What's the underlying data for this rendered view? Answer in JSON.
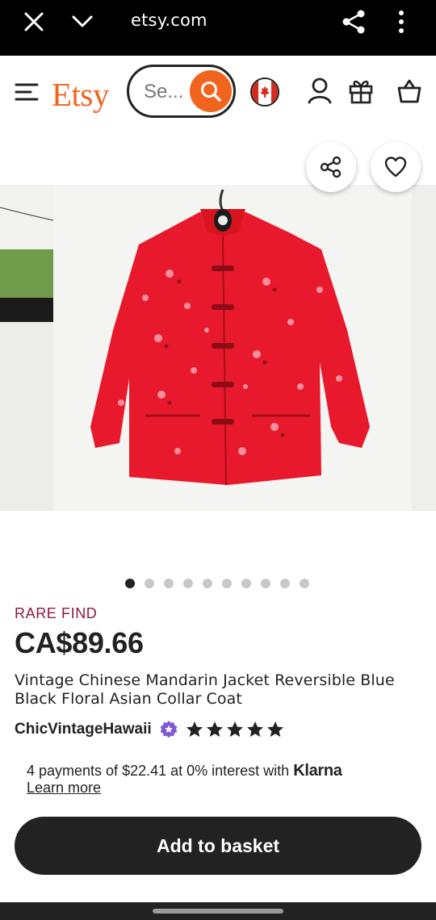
{
  "browser": {
    "url": "etsy.com",
    "icons": [
      "close-icon",
      "chevron-down-icon",
      "share-icon",
      "more-vert-icon"
    ]
  },
  "header": {
    "logo": "Etsy",
    "search_placeholder": "Se...",
    "icons": [
      "menu-icon",
      "search-icon",
      "canada-flag-icon",
      "user-icon",
      "gift-icon",
      "basket-icon"
    ]
  },
  "gallery": {
    "image_count": 10,
    "active_index": 0
  },
  "product": {
    "badge": "RARE FIND",
    "price": "CA$89.66",
    "title": "Vintage Chinese Mandarin Jacket Reversible Blue Black Floral Asian Collar Coat",
    "seller": "ChicVintageHawaii",
    "rating": 5,
    "max_rating": 5,
    "installments_text": "4 payments of $22.41 at 0% interest with ",
    "installments_brand": "Klarna",
    "learn_more": "Learn more",
    "add_button": "Add to basket"
  },
  "colors": {
    "brand_orange": "#f1641e",
    "badge_maroon": "#8f1a3c",
    "button_dark": "#222222",
    "star_seller_purple": "#7f58d6"
  }
}
